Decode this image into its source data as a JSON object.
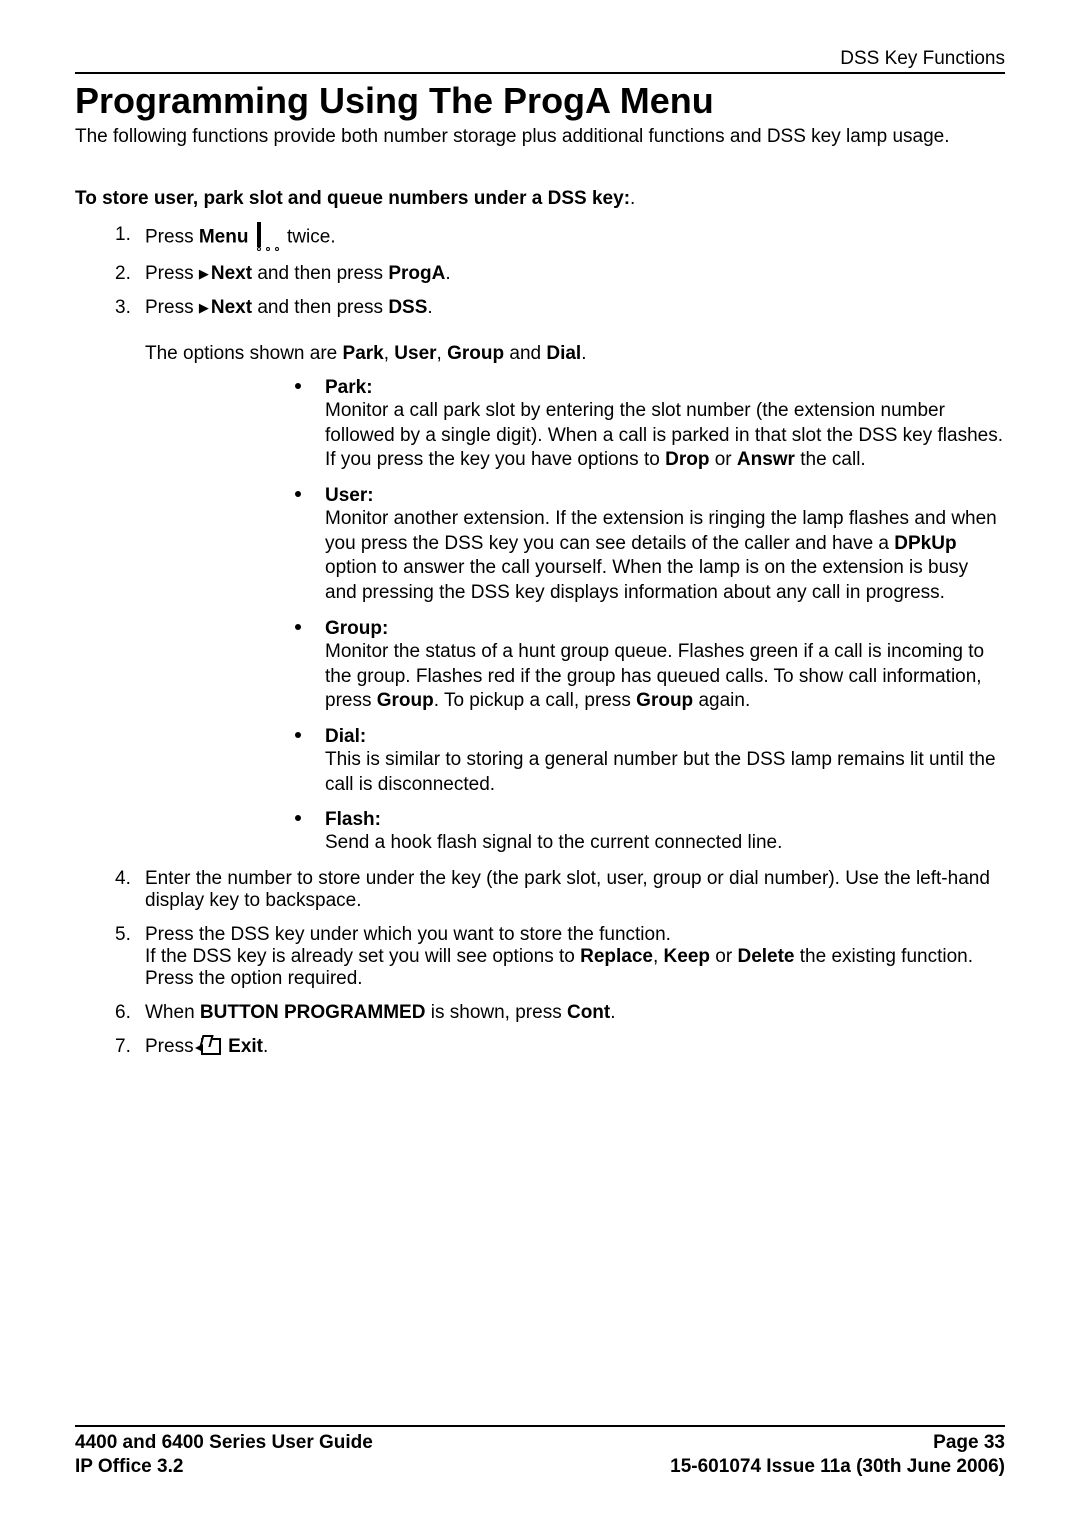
{
  "header": "DSS Key Functions",
  "title": "Programming Using The ProgA Menu",
  "intro": "The following functions provide both number storage plus additional functions and DSS key lamp usage.",
  "subhead": "To store user, park slot and queue numbers under a DSS key:",
  "subhead_suffix": ".",
  "step1": {
    "num": "1.",
    "pre": "Press ",
    "menu": "Menu",
    "post": " twice."
  },
  "step2": {
    "num": "2.",
    "press": "Press ",
    "next": "Next",
    "mid": " and then press ",
    "proga": "ProgA",
    "end": "."
  },
  "step3": {
    "num": "3.",
    "press": "Press ",
    "next": "Next",
    "mid": " and then press ",
    "dss": "DSS",
    "end": "."
  },
  "options_intro": {
    "pre": "The options shown are ",
    "park": "Park",
    "c1": ", ",
    "user": "User",
    "c2": ", ",
    "group": "Group",
    "and": " and ",
    "dial": "Dial",
    "end": "."
  },
  "inner": {
    "park": {
      "label": "Park:",
      "p1": "Monitor a call park slot by entering the slot number (the extension number followed by a single digit). When a call is parked in that slot the DSS key flashes. If you press the key you have options to ",
      "drop": "Drop",
      "or": " or ",
      "answr": "Answr",
      "p2": " the call."
    },
    "user": {
      "label": "User:",
      "p1": "Monitor another extension. If the extension is ringing the lamp flashes and when you press the DSS key you can see details of the caller and have a ",
      "dpkup": "DPkUp",
      "p2": " option to answer the call yourself. When the lamp is on the extension is busy and pressing the DSS key displays information about any call in progress."
    },
    "group": {
      "label": "Group:",
      "p1": "Monitor the status of a hunt group queue. Flashes green if a call is incoming to the group. Flashes red if the group has queued calls. To show call information, press ",
      "g1": "Group",
      "mid": ". To pickup a call, press ",
      "g2": "Group",
      "end": " again."
    },
    "dial": {
      "label": "Dial:",
      "desc": "This is similar to storing a general number but the DSS lamp remains lit until the call is disconnected."
    },
    "flash": {
      "label": "Flash:",
      "desc": "Send a hook flash signal to the current connected line."
    }
  },
  "step4": {
    "num": "4.",
    "text": "Enter the number to store under the key (the park slot, user, group or dial number). Use the left-hand display key to backspace."
  },
  "step5": {
    "num": "5.",
    "l1": "Press the DSS key under which you want to store the function.",
    "l2a": "If the DSS key is already set you will see options to ",
    "replace": "Replace",
    "c1": ", ",
    "keep": "Keep",
    "or": " or ",
    "delete": "Delete",
    "l2b": " the existing function. Press the option required."
  },
  "step6": {
    "num": "6.",
    "pre": "When ",
    "bp": "BUTTON PROGRAMMED",
    "mid": " is shown, press ",
    "cont": "Cont",
    "end": "."
  },
  "step7": {
    "num": "7.",
    "pre": "Press ",
    "exit": "Exit",
    "end": "."
  },
  "tri": "▶",
  "footer": {
    "l1": "4400 and 6400 Series User Guide",
    "l2": "IP Office 3.2",
    "r1": "Page 33",
    "r2": "15-601074 Issue 11a (30th June 2006)"
  }
}
